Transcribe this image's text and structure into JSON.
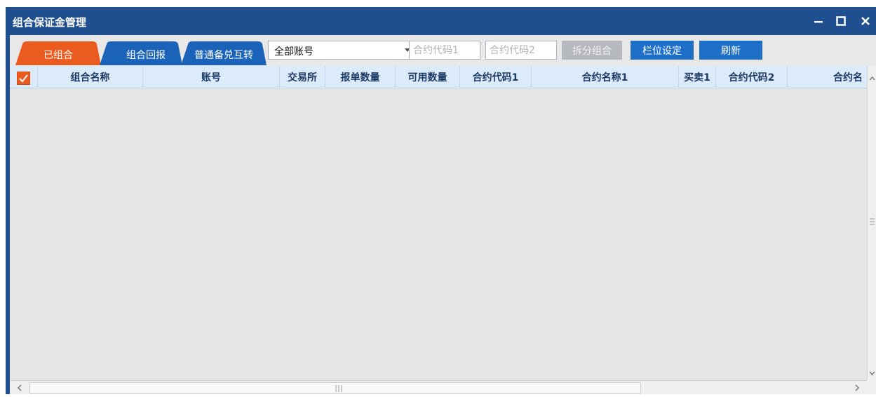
{
  "window": {
    "title": "组合保证金管理",
    "colors": {
      "titlebar": "#1f4f8f",
      "active_tab": "#e95b1f",
      "tab": "#1a63b8",
      "primary_button": "#1e6fc8"
    }
  },
  "tabs": [
    {
      "label": "已组合",
      "active": true
    },
    {
      "label": "组合回报",
      "active": false
    },
    {
      "label": "普通备兑互转",
      "active": false
    }
  ],
  "filters": {
    "account_select": {
      "value": "全部账号"
    },
    "contract_code_1": {
      "placeholder": "合约代码1",
      "value": ""
    },
    "contract_code_2": {
      "placeholder": "合约代码2",
      "value": ""
    }
  },
  "buttons": {
    "split": {
      "label": "拆分组合",
      "disabled": true
    },
    "columns": {
      "label": "栏位设定"
    },
    "refresh": {
      "label": "刷新"
    }
  },
  "table": {
    "select_all_checked": true,
    "columns": [
      "组合名称",
      "账号",
      "交易所",
      "报单数量",
      "可用数量",
      "合约代码1",
      "合约名称1",
      "买卖1",
      "合约代码2",
      "合约名"
    ],
    "rows": []
  },
  "icons": {
    "minimize": "minimize-icon",
    "maximize": "maximize-icon",
    "close": "close-icon",
    "checkbox": "check-icon",
    "dropdown": "chevron-down-icon"
  }
}
